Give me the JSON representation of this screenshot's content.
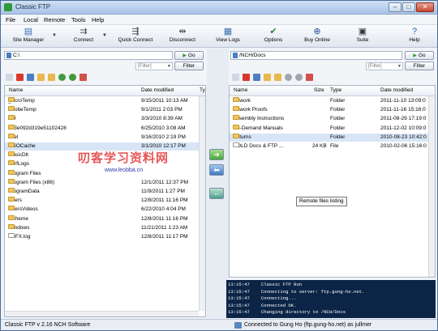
{
  "title": "Classic FTP",
  "menu": [
    "File",
    "Local",
    "Remote",
    "Tools",
    "Help"
  ],
  "toolbar": [
    {
      "label": "Site Manager",
      "icon": "site-manager-icon"
    },
    {
      "label": "Connect",
      "icon": "connect-icon"
    },
    {
      "label": "Quick Connect",
      "icon": "quick-connect-icon"
    },
    {
      "label": "Disconnect",
      "icon": "disconnect-icon"
    },
    {
      "label": "View Logs",
      "icon": "view-logs-icon"
    },
    {
      "label": "Options",
      "icon": "options-icon"
    },
    {
      "label": "Buy Online",
      "icon": "buy-online-icon"
    },
    {
      "label": "Suite",
      "icon": "suite-icon"
    },
    {
      "label": "Help",
      "icon": "help-icon"
    }
  ],
  "local": {
    "path": "C:\\",
    "go": "Go",
    "filter_placeholder": "[Filter]",
    "filter_button": "Filter",
    "columns": [
      "Name",
      "Date modified",
      "Ty"
    ],
    "rows": [
      {
        "name": "_AcroTemp",
        "date": "9/15/2011 10:13 AM",
        "type": "Fil",
        "folder": true
      },
      {
        "name": "AdobeTemp",
        "date": "9/1/2011 2:03 PM",
        "type": "Fil",
        "folder": true
      },
      {
        "name": "ATI",
        "date": "3/3/2010 8:39 AM",
        "type": "Fil",
        "folder": true
      },
      {
        "name": "b93e092d319e51102428",
        "date": "6/25/2010 3:08 AM",
        "type": "Fil",
        "folder": true
      },
      {
        "name": "Intel",
        "date": "9/16/2010 2:19 PM",
        "type": "Fil",
        "folder": true
      },
      {
        "name": "MSOCache",
        "date": "3/1/2010 12:17 PM",
        "type": "Fil",
        "folder": true
      },
      {
        "name": "MusicDlt",
        "date": "",
        "type": "",
        "folder": true
      },
      {
        "name": "PerfLogs",
        "date": "",
        "type": "",
        "folder": true
      },
      {
        "name": "Program Files",
        "date": "",
        "type": "",
        "folder": true
      },
      {
        "name": "Program Files (x86)",
        "date": "12/1/2011 12:37 PM",
        "type": "Fil",
        "folder": true
      },
      {
        "name": "ProgramData",
        "date": "11/9/2011 1:27 PM",
        "type": "Fil",
        "folder": true
      },
      {
        "name": "Users",
        "date": "12/8/2011 11:16 PM",
        "type": "Fil",
        "folder": true
      },
      {
        "name": "UsersVideos",
        "date": "6/22/2010 4:04 PM",
        "type": "Fil",
        "folder": true
      },
      {
        "name": "uxtheme",
        "date": "12/8/2011 11:16 PM",
        "type": "Fil",
        "folder": true
      },
      {
        "name": "Windows",
        "date": "11/21/2011 1:23 AM",
        "type": "Fil",
        "folder": true
      },
      {
        "name": "IcoFX.log",
        "date": "12/8/2011 11:17 PM",
        "type": "Tex",
        "folder": false
      }
    ]
  },
  "remote": {
    "path": "/NCH/Docs",
    "go": "Go",
    "filter_placeholder": "[Filter]",
    "filter_button": "Filter",
    "columns": [
      "Name",
      "Size",
      "Type",
      "Date modified"
    ],
    "rows": [
      {
        "name": "Artwork",
        "size": "",
        "type": "Folder",
        "date": "2011-11-10 13:09:0",
        "folder": true
      },
      {
        "name": "Artwork Proofs",
        "size": "",
        "type": "Folder",
        "date": "2011-11-16 15:16:0",
        "folder": true
      },
      {
        "name": "Assembly Instructions",
        "size": "",
        "type": "Folder",
        "date": "2011-08-29 17:19:0",
        "folder": true
      },
      {
        "name": "On-Demand Manuals",
        "size": "",
        "type": "Folder",
        "date": "2011-12-02 10:09:0",
        "folder": true
      },
      {
        "name": "Returns",
        "size": "",
        "type": "Folder",
        "date": "2010-08-23 10:42:0",
        "folder": true
      },
      {
        "name": "GOLD Docs & FTP ...",
        "size": "24 KB",
        "type": "File",
        "date": "2010-02-06 15:16:0",
        "folder": false
      }
    ],
    "tooltip": "Remote files listing"
  },
  "log": [
    {
      "time": "13:15:47",
      "msg": "Classic FTP Run"
    },
    {
      "time": "13:15:47",
      "msg": "Connecting to server: ftp.gung-ho.net."
    },
    {
      "time": "13:15:47",
      "msg": "Connecting..."
    },
    {
      "time": "13:15:47",
      "msg": "Connected OK."
    },
    {
      "time": "13:15:47",
      "msg": "Changing directory to /NCH/Docs"
    }
  ],
  "status": {
    "left": "Classic FTP v 2.16  NCH Software",
    "right": "Connected to Gung Ho (ftp.gung-ho.net) as jullmer"
  },
  "watermark": {
    "text": "叨客学习资料网",
    "url": "www.leobba.cn"
  }
}
